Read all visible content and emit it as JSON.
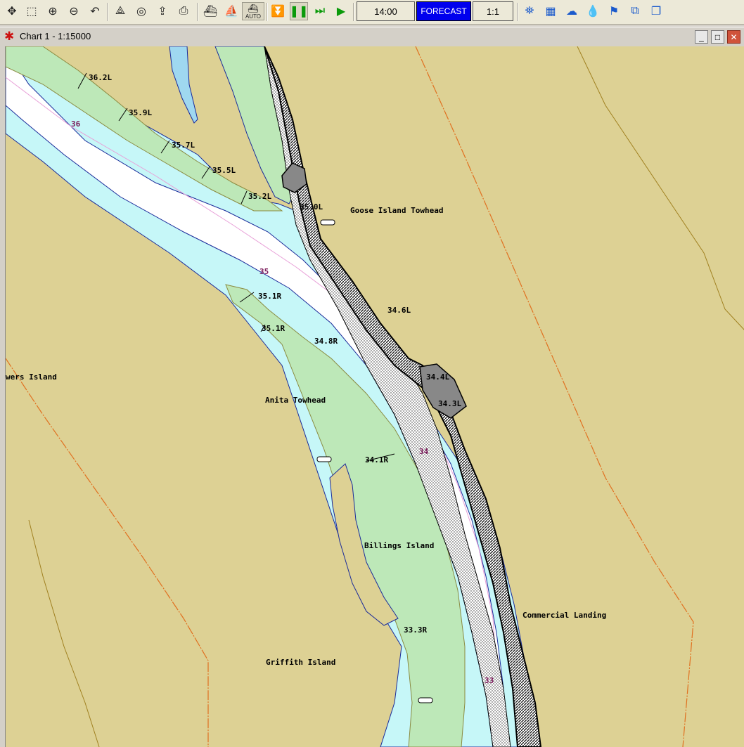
{
  "toolbar": {
    "clock": "14:00",
    "forecast_label": "FORECAST",
    "scale_ratio": "1:1",
    "auto_label": "AUTO",
    "tools": [
      "pan-icon",
      "zoom-box-icon",
      "zoom-in-icon",
      "zoom-out-icon",
      "undo-icon",
      "measure-icon",
      "target-icon",
      "export-icon",
      "print-icon",
      "vessel-icon",
      "route-icon",
      "auto-icon",
      "stop-icon",
      "pause-icon",
      "fast-forward-icon",
      "play-icon",
      "satellite-icon",
      "graph-icon",
      "weather-icon",
      "water-level-icon",
      "marker-icon",
      "copy-icon",
      "windows-icon"
    ]
  },
  "window": {
    "title": "Chart 1 - 1:15000",
    "minimize_symbol": "_",
    "maximize_symbol": "□",
    "close_symbol": "✕"
  },
  "map": {
    "colors": {
      "land": "#ddd194",
      "shallow_water": "#c6f7f8",
      "deep_water": "#ffffff",
      "sandbar": "#bde8b8",
      "shore": "#000000",
      "sailing_line": "#e8a0d8",
      "boundary": "#e07020",
      "river_mile": "#7a1a5a"
    },
    "place_names": {
      "goose": "Goose Island Towhead",
      "bowers": "wers Island",
      "anita": "Anita Towhead",
      "billings": "Billings Island",
      "commercial": "Commercial Landing",
      "griffith": "Griffith Island"
    },
    "markers": {
      "m362": "36.2L",
      "m359": "35.9L",
      "m357": "35.7L",
      "m355": "35.5L",
      "m352": "35.2L",
      "m350": "35.0L",
      "m346": "34.6L",
      "m351a": "35.1R",
      "m351b": "35.1R",
      "m348": "34.8R",
      "m344": "34.4L",
      "m343": "34.3L",
      "m341": "34.1R",
      "m333": "33.3R"
    },
    "river_miles": {
      "r36": "36",
      "r35": "35",
      "r34": "34",
      "r33": "33"
    }
  }
}
